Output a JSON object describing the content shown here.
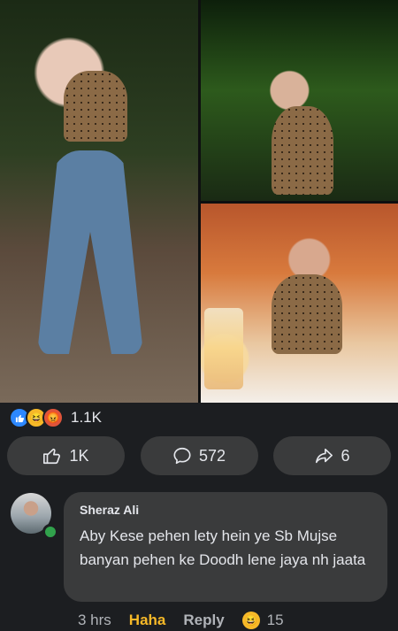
{
  "post": {
    "reactions": {
      "icons": [
        "like-icon",
        "haha-icon",
        "angry-icon"
      ],
      "count": "1.1K"
    },
    "actions": {
      "like_count": "1K",
      "comment_count": "572",
      "share_count": "6"
    }
  },
  "comment": {
    "author": "Sheraz Ali",
    "text": "Aby Kese pehen lety hein ye Sb Mujse banyan pehen ke Doodh lene jaya nh jaata",
    "time": "3 hrs",
    "reaction_label": "Haha",
    "reply_label": "Reply",
    "reaction_count": "15"
  },
  "colors": {
    "accent": "#2d88ff",
    "haha": "#f7b928",
    "angry": "#e0543a",
    "online": "#31a24c"
  }
}
